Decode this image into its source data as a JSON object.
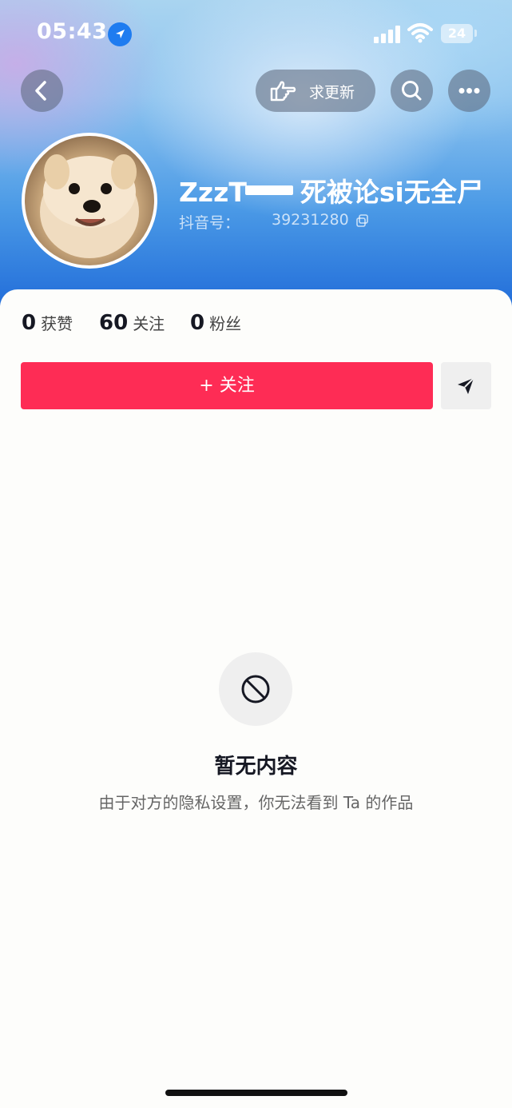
{
  "status_bar": {
    "time": "05:43",
    "battery": "24",
    "icons": [
      "location-arrow-icon",
      "signal-icon",
      "wifi-icon",
      "battery-icon"
    ]
  },
  "nav": {
    "back_icon": "chevron-left-icon",
    "update_label": "求更新",
    "update_icon": "pointing-hand-icon",
    "search_icon": "search-icon",
    "more_icon": "more-dots-icon"
  },
  "profile": {
    "username_prefix": "ZzzT",
    "username_suffix": "死被论si无全尸",
    "douyin_id_label": "抖音号：",
    "douyin_id_value": "39231280",
    "avatar_icon": "dog-avatar-image"
  },
  "stats": [
    {
      "value": "0",
      "label": "获赞"
    },
    {
      "value": "60",
      "label": "关注"
    },
    {
      "value": "0",
      "label": "粉丝"
    }
  ],
  "actions": {
    "follow_label": "+ 关注",
    "share_icon": "send-icon"
  },
  "empty_state": {
    "icon": "prohibited-icon",
    "title": "暂无内容",
    "description": "由于对方的隐私设置，你无法看到 Ta 的作品"
  },
  "colors": {
    "accent": "#fe2c55",
    "header_blue": "#1d68d8"
  }
}
